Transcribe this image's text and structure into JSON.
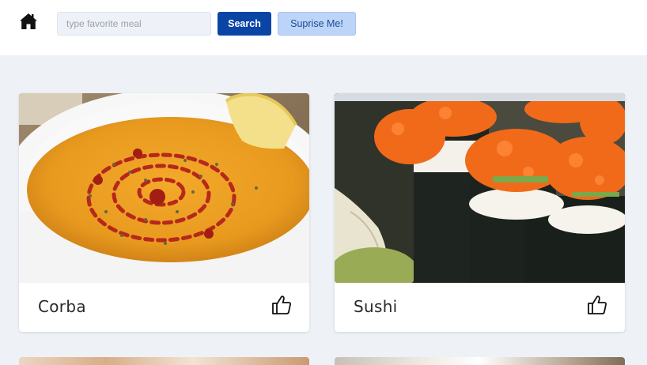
{
  "header": {
    "home_icon": "home-icon",
    "search": {
      "placeholder": "type favorite meal",
      "value": ""
    },
    "search_label": "Search",
    "surprise_label": "Suprise Me!"
  },
  "meals": [
    {
      "name": "Corba",
      "like_icon": "thumbs-up-icon"
    },
    {
      "name": "Sushi",
      "like_icon": "thumbs-up-icon"
    }
  ],
  "colors": {
    "page_bg": "#eef1f6",
    "header_bg": "#ffffff",
    "primary": "#0a45a6",
    "secondary": "#bcd4f8"
  }
}
